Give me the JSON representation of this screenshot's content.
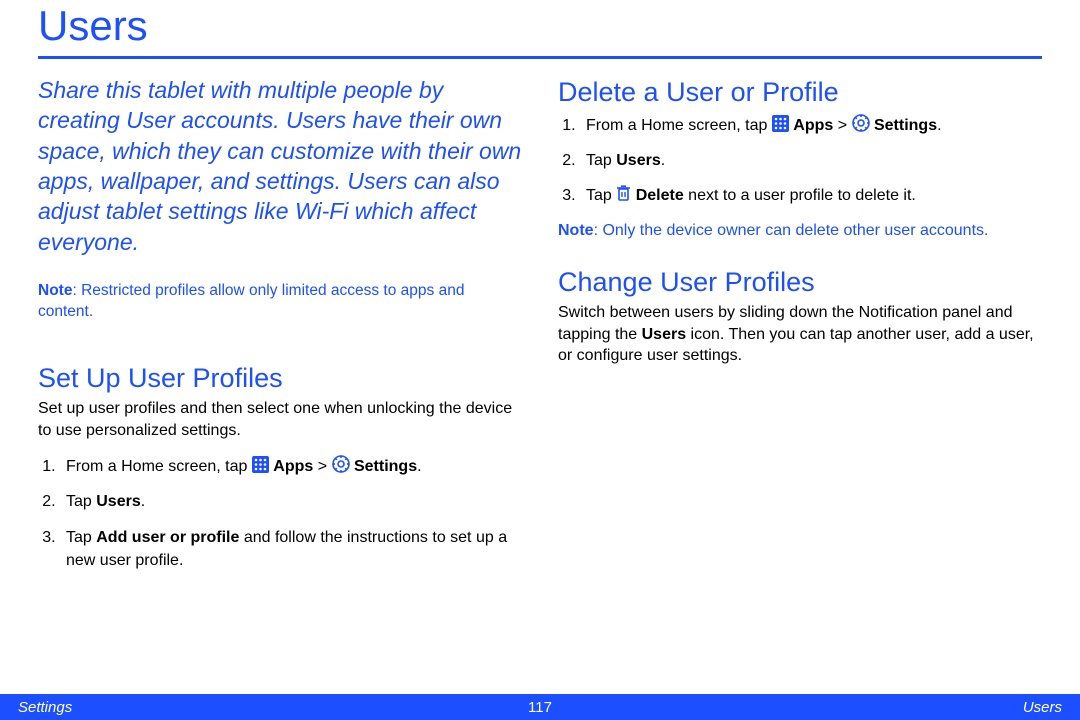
{
  "title": "Users",
  "intro": "Share this tablet with multiple people by creating User accounts. Users have their own space, which they can customize with their own apps, wallpaper, and settings. Users can also adjust tablet settings like Wi-Fi which affect everyone.",
  "note1_label": "Note",
  "note1_text": ": Restricted profiles allow only limited access to apps and content.",
  "setup_heading": "Set Up User Profiles",
  "setup_body": "Set up user profiles and then select one when unlocking the device to use personalized settings.",
  "setup_steps": {
    "s1_prefix": "From a Home screen, tap ",
    "s1_apps": "Apps",
    "s1_gt": " > ",
    "s1_settings": "Settings",
    "s1_suffix": ".",
    "s2_prefix": "Tap ",
    "s2_bold": "Users",
    "s2_suffix": ".",
    "s3_prefix": "Tap ",
    "s3_bold": "Add user or profile",
    "s3_suffix": " and follow the instructions to set up a new user profile."
  },
  "delete_heading": "Delete a User or Profile",
  "delete_steps": {
    "s1_prefix": "From a Home screen, tap ",
    "s1_apps": "Apps",
    "s1_gt": " > ",
    "s1_settings": "Settings",
    "s1_suffix": ".",
    "s2_prefix": "Tap ",
    "s2_bold": "Users",
    "s2_suffix": ".",
    "s3_prefix": "Tap ",
    "s3_bold": "Delete",
    "s3_suffix": " next to a user profile to delete it."
  },
  "note2_label": "Note",
  "note2_text": ": Only the device owner can delete other user accounts.",
  "change_heading": "Change User Profiles",
  "change_body_a": "Switch between users by sliding down the Notification panel and tapping the ",
  "change_body_bold": "Users",
  "change_body_b": " icon. Then you can tap another user, add a user, or configure user settings.",
  "footer": {
    "left": "Settings",
    "center": "117",
    "right": "Users"
  },
  "colors": {
    "accent": "#1c4fff"
  }
}
